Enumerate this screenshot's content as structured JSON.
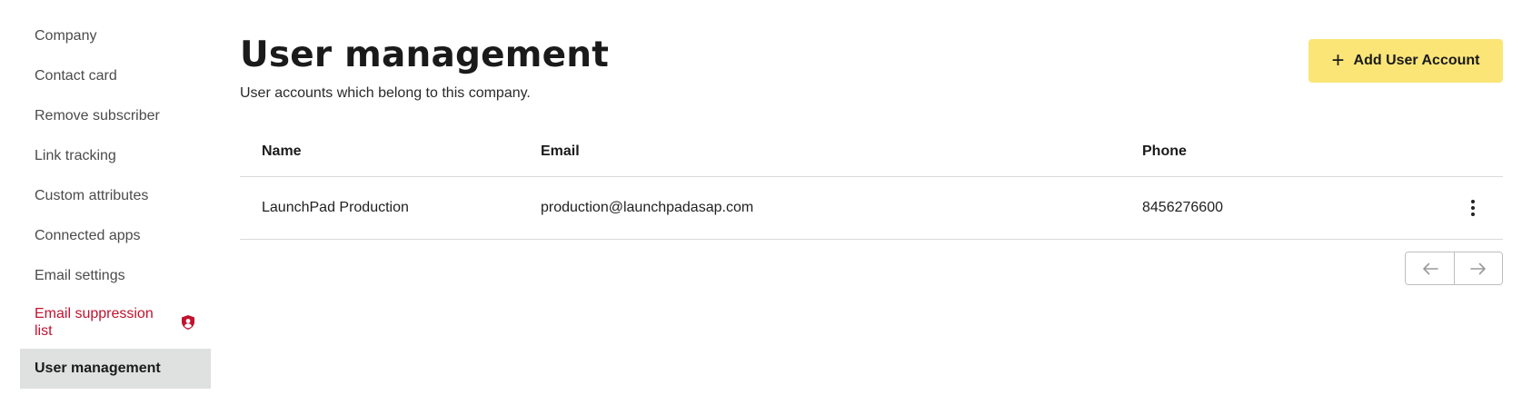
{
  "sidebar": {
    "items": [
      {
        "label": "Company"
      },
      {
        "label": "Contact card"
      },
      {
        "label": "Remove subscriber"
      },
      {
        "label": "Link tracking"
      },
      {
        "label": "Custom attributes"
      },
      {
        "label": "Connected apps"
      },
      {
        "label": "Email settings"
      },
      {
        "label": "Email suppression list",
        "icon": "shield-person-icon"
      },
      {
        "label": "User management"
      }
    ]
  },
  "header": {
    "title": "User management",
    "subtitle": "User accounts which belong to this company.",
    "add_button_label": "Add User Account"
  },
  "table": {
    "columns": [
      "Name",
      "Email",
      "Phone"
    ],
    "rows": [
      {
        "name": "LaunchPad Production",
        "email": "production@launchpadasap.com",
        "phone": "8456276600"
      }
    ]
  },
  "colors": {
    "accent_yellow": "#fbe577",
    "danger_red": "#c1122f",
    "active_bg": "#dfe0e0"
  }
}
